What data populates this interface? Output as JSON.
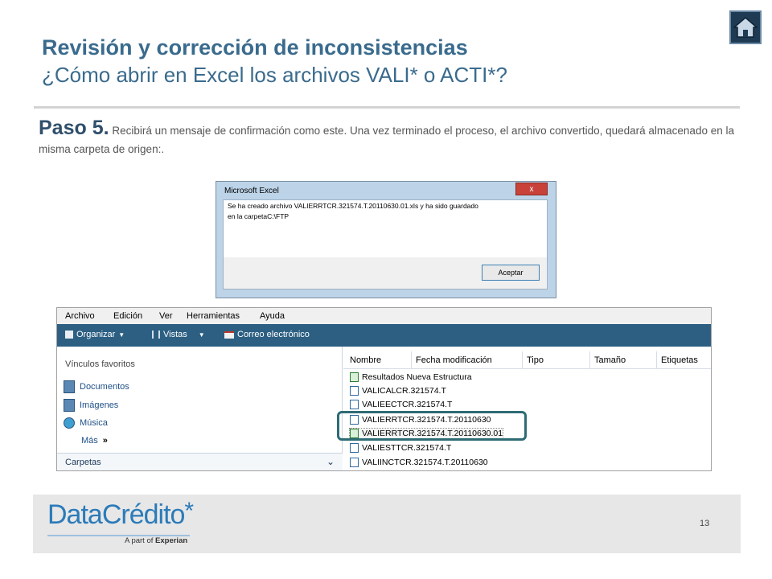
{
  "header": {
    "title": "Revisión y corrección de inconsistencias",
    "subtitle": "¿Cómo abrir en Excel los archivos VALI* o ACTI*?",
    "home_icon": "home-icon"
  },
  "step": {
    "label": "Paso 5.",
    "text": " Recibirá un mensaje de confirmación como este. Una vez terminado el proceso, el archivo convertido, quedará almacenado en la misma carpeta de origen:."
  },
  "dialog": {
    "title": "Microsoft Excel",
    "close": "x",
    "message_line1": "Se ha creado archivo VALIERRTCR.321574.T.20110630.01.xls y ha sido guardado",
    "message_line2": "en la carpetaC:\\FTP",
    "ok_label": "Aceptar"
  },
  "explorer": {
    "menu": [
      "Archivo",
      "Edición",
      "Ver",
      "Herramientas",
      "Ayuda"
    ],
    "toolbar": [
      "Organizar",
      "Vistas",
      "Correo electrónico"
    ],
    "sidebar": {
      "heading": "Vínculos favoritos",
      "items": [
        "Documentos",
        "Imágenes",
        "Música"
      ],
      "more": "Más",
      "folders": "Carpetas"
    },
    "columns": [
      "Nombre",
      "Fecha modificación",
      "Tipo",
      "Tamaño",
      "Etiquetas"
    ],
    "files": [
      "Resultados Nueva Estructura",
      "VALICALCR.321574.T",
      "VALIEECTCR.321574.T",
      "VALIERRTCR.321574.T.20110630",
      "VALIERRTCR.321574.T.20110630.01",
      "VALIESTTCR.321574.T",
      "VALIINCTCR.321574.T.20110630"
    ]
  },
  "footer": {
    "logo": "DataCrédito",
    "logo_star": "*",
    "tagline_prefix": "A part of ",
    "tagline_brand": "Experian",
    "page_number": "13"
  },
  "colors": {
    "title": "#3a6b8d",
    "toolbar": "#2c5f82",
    "highlight": "#2e6b75",
    "logo": "#2b7bb9"
  }
}
